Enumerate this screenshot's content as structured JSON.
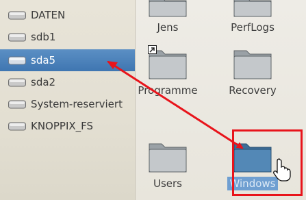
{
  "sidebar": {
    "items": [
      {
        "label": "DATEN",
        "selected": false
      },
      {
        "label": "sdb1",
        "selected": false
      },
      {
        "label": "sda5",
        "selected": true
      },
      {
        "label": "sda2",
        "selected": false
      },
      {
        "label": "System-reserviert",
        "selected": false
      },
      {
        "label": "KNOPPIX_FS",
        "selected": false
      }
    ]
  },
  "content": {
    "items": [
      {
        "name": "Jens",
        "icon": "folder-icon",
        "selected": false
      },
      {
        "name": "PerfLogs",
        "icon": "folder-icon",
        "selected": false
      },
      {
        "name": "Programme",
        "icon": "folder-link-icon",
        "selected": false
      },
      {
        "name": "Recovery",
        "icon": "folder-icon",
        "selected": false
      },
      {
        "name": "Users",
        "icon": "folder-icon",
        "selected": false
      },
      {
        "name": "Windows",
        "icon": "folder-icon",
        "selected": true
      }
    ]
  },
  "annotations": {
    "arrow_color": "#e8141b",
    "highlight_color": "#e8141b"
  },
  "colors": {
    "selection": "#4a82bc",
    "folder_selected": "#4f7fa8"
  }
}
